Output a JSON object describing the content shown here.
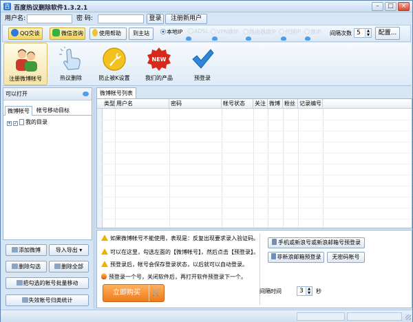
{
  "window": {
    "title": "百度热议删除软件1.3.2.1",
    "min": "–",
    "max": "□",
    "close": "×"
  },
  "login": {
    "username_label": "用户名:",
    "username_value": "",
    "password_label": "密  码:",
    "password_value": "",
    "login_button": "登录",
    "register_button": "注册新用户"
  },
  "toolbar": {
    "qq_button": "QQ交谈",
    "wechat_button": "微信咨询",
    "help_button": "使用帮助",
    "home_button": "到主站",
    "radios": [
      {
        "label": "本地IP",
        "selected": true,
        "enabled": true
      },
      {
        "label": "ADSL",
        "selected": false,
        "enabled": false
      },
      {
        "label": "VPN换IP",
        "selected": false,
        "enabled": false
      },
      {
        "label": "路由器换IP",
        "selected": false,
        "enabled": false
      },
      {
        "label": "代理IP",
        "selected": false,
        "enabled": false
      },
      {
        "label": "换IP",
        "selected": false,
        "enabled": false
      }
    ],
    "interval_label": "间隔次数",
    "interval_value": "5",
    "config_button": "配置..."
  },
  "big_toolbar": {
    "items": [
      {
        "label": "注册微博帐号",
        "icon": "users-icon",
        "selected": true
      },
      {
        "label": "热议删除",
        "icon": "pointer-hand-icon",
        "selected": false
      },
      {
        "label": "防止被K设置",
        "icon": "wrench-icon",
        "selected": false
      },
      {
        "label": "我们的产品",
        "icon": "new-badge-icon",
        "selected": false
      },
      {
        "label": "预登录",
        "icon": "checkmark-icon",
        "selected": false
      }
    ]
  },
  "left_panel": {
    "header": "可以打开",
    "tabs": [
      "微博帐号",
      "帐号移动目标"
    ],
    "tree": {
      "root_label": "我的目录",
      "expand": "+",
      "checked": true
    },
    "buttons": {
      "add_weibo": "添加微博",
      "import_export": "导入导出",
      "delete_checked": "删除勾选",
      "delete_all": "删除全部",
      "batch_move": "把勾选的帐号批量移动",
      "invalid_stats": "失效帐号归类统计"
    }
  },
  "grid": {
    "tab_label": "微博帐号列表",
    "columns": [
      "类型",
      "用户名",
      "密码",
      "帐号状态",
      "关注",
      "微博",
      "粉丝",
      "记录编号"
    ]
  },
  "info": {
    "tips": [
      "如果微博帐号不能使用，表现是：反复出现要求录入验证码。",
      "可以在这里，勾选左面的【微博帐号】，然后点击【预登录】。",
      "预登录后，帐号会保存登录状态，以后就可以自动登录。",
      "预登录一个号，关闭软件后，再打开软件预登录下一个。"
    ],
    "buy_button": "立即购买",
    "mobile_prelogin": "手机或新浪号或新浪邮箱号预登录",
    "nonsina_prelogin": "非新浪邮箱预登录",
    "nopassword": "无密码帐号",
    "interval_label": "间隔时间",
    "interval_value": "3",
    "interval_unit": "秒"
  }
}
